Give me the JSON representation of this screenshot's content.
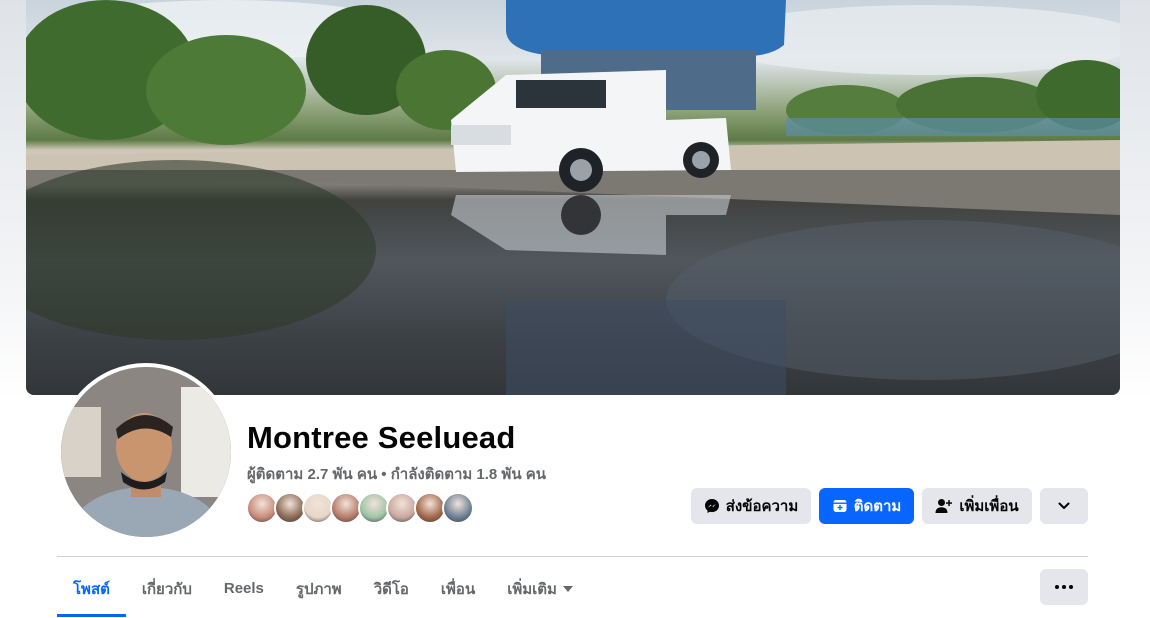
{
  "profile": {
    "name": "Montree Seeluead",
    "stats": "ผู้ติดตาม 2.7 พัน คน • กำลังติดตาม 1.8 พัน คน"
  },
  "actions": {
    "message_label": "ส่งข้อความ",
    "follow_label": "ติดตาม",
    "add_friend_label": "เพิ่มเพื่อน"
  },
  "tabs": [
    {
      "label": "โพสต์",
      "active": true
    },
    {
      "label": "เกี่ยวกับ",
      "active": false
    },
    {
      "label": "Reels",
      "active": false
    },
    {
      "label": "รูปภาพ",
      "active": false
    },
    {
      "label": "วิดีโอ",
      "active": false
    },
    {
      "label": "เพื่อน",
      "active": false
    },
    {
      "label": "เพิ่มเติม",
      "active": false
    }
  ],
  "friend_avatar_colors": [
    "#c98b7a",
    "#8a6a55",
    "#e8d7c8",
    "#b77b6a",
    "#9ec4a6",
    "#c9a8a0",
    "#a3664a",
    "#6d7f94"
  ],
  "colors": {
    "accent": "#0866ff",
    "button_grey": "#e4e6eb",
    "text_secondary": "#65676b"
  }
}
